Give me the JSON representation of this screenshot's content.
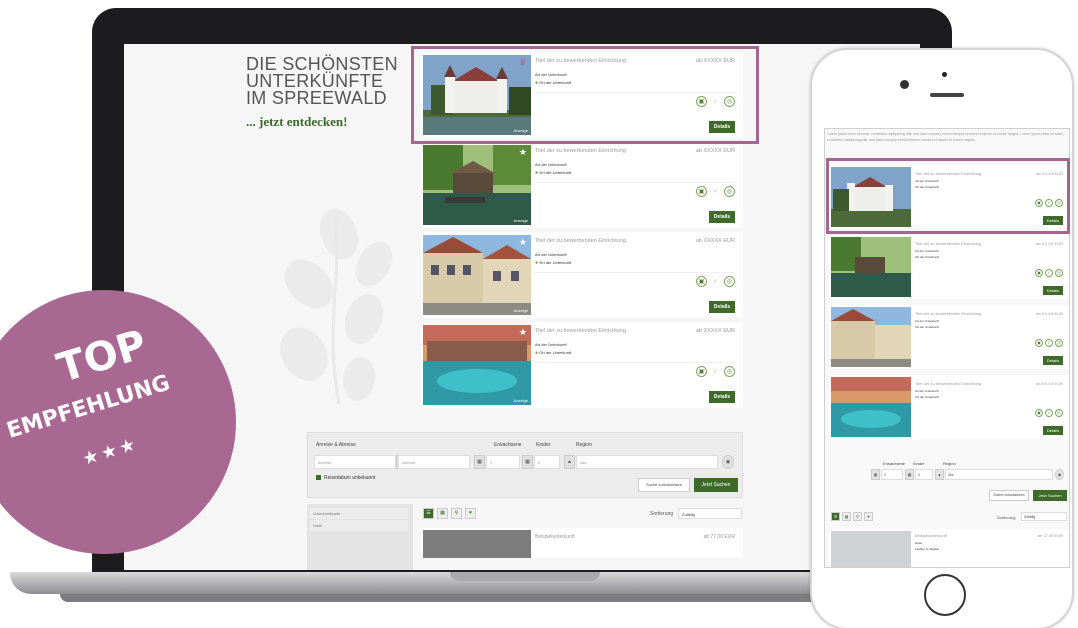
{
  "laptop": {
    "hero_title_line1": "DIE SCHÖNSTEN",
    "hero_title_line2": "UNTERKÜNFTE",
    "hero_title_line3": "IM SPREEWALD",
    "hero_subtitle": "... jetzt entdecken!",
    "cards": [
      {
        "title": "Titel der zu bewerbenden Einrichtung",
        "price": "ab XXXXX EUR",
        "type": "Art der Unterkunft",
        "place": "Ort der Unterkunft",
        "details": "Details",
        "anzeige": "Anzeige",
        "fav_icon": "trophy-icon"
      },
      {
        "title": "Titel der zu bewerbenden Einrichtung",
        "price": "ab XXXXX EUR",
        "type": "Art der Unterkunft",
        "place": "Ort der Unterkunft",
        "details": "Details",
        "anzeige": "Anzeige",
        "fav_icon": "star-icon"
      },
      {
        "title": "Titel der zu bewerbenden Einrichtung",
        "price": "ab XXXXX EUR",
        "type": "Art der Unterkunft",
        "place": "Ort der Unterkunft",
        "details": "Details",
        "anzeige": "Anzeige",
        "fav_icon": "star-icon"
      },
      {
        "title": "Titel der zu bewerbenden Einrichtung",
        "price": "ab XXXXX EUR",
        "type": "Art der Unterkunft",
        "place": "Ort der Unterkunft",
        "details": "Details",
        "anzeige": "Anzeige",
        "fav_icon": "star-icon"
      }
    ],
    "search": {
      "dates_label": "Anreise & Abreise",
      "adults_label": "Erwachsene",
      "kids_label": "Kinder",
      "region_label": "Region",
      "arrival_placeholder": "Anreise",
      "departure_placeholder": "Abreise",
      "adults_value": "2",
      "kids_value": "0",
      "region_value": "Alle",
      "unknown_date_label": "Reisedatum unbekannt",
      "reset_label": "Suche zurücksetzen",
      "submit_label": "Jetzt Suchen"
    },
    "filter": {
      "type_label": "Unterkunftsarte",
      "type_value": "Hotel"
    },
    "sort_label": "Sortierung",
    "sort_value": "Zufällig",
    "card5": {
      "title": "Beispielunterkunft",
      "price": "ab 77,00 EUR"
    }
  },
  "phone": {
    "intro": "Lorem ipsum dolor sit amet, consetetur sadipscing elitr, sed diam nonumy eirmod tempor invidunt ut labore et dolore magna. Lorem ipsum dolor sit amet, consetetur sadipscing elitr, sed diam nonumy eirmod tempor invidunt ut labore et dolore magna.",
    "cards": [
      {
        "title": "Titel der zu bewerbenden Einrichtung",
        "price": "ab XX,XX EUR",
        "type": "Art der Unterkunft",
        "place": "Ort der Unterkunft",
        "details": "Details"
      },
      {
        "title": "Titel der zu bewerbenden Einrichtung",
        "price": "ab XX,XX EUR",
        "type": "Art der Unterkunft",
        "place": "Ort der Unterkunft",
        "details": "Details"
      },
      {
        "title": "Titel der zu bewerbenden Einrichtung",
        "price": "ab XX,XX EUR",
        "type": "Art der Unterkunft",
        "place": "Ort der Unterkunft",
        "details": "Details"
      },
      {
        "title": "Titel der zu bewerbenden Einrichtung",
        "price": "ab XX,XX EUR",
        "type": "Art der Unterkunft",
        "place": "Ort der Unterkunft",
        "details": "Details"
      }
    ],
    "search": {
      "adults_label": "Erwachsene",
      "kids_label": "Kinder",
      "region_label": "Region",
      "adults_value": "2",
      "kids_value": "0",
      "region_value": "Alle",
      "reset_label": "Suche zurücksetzen",
      "submit_label": "Jetzt Suchen"
    },
    "sort_label": "Sortierung",
    "sort_value": "Zufällig",
    "card5": {
      "title": "Beispielunterkunft",
      "price": "ab 77,00 EUR",
      "type": "Hotel",
      "place": "Lauffen im Neckar"
    }
  },
  "badge": {
    "line1": "TOP",
    "line2": "EMPFEHLUNG",
    "stars": "★★★"
  },
  "colors": {
    "accent_purple": "#a96892",
    "brand_green": "#3f6b2a"
  }
}
